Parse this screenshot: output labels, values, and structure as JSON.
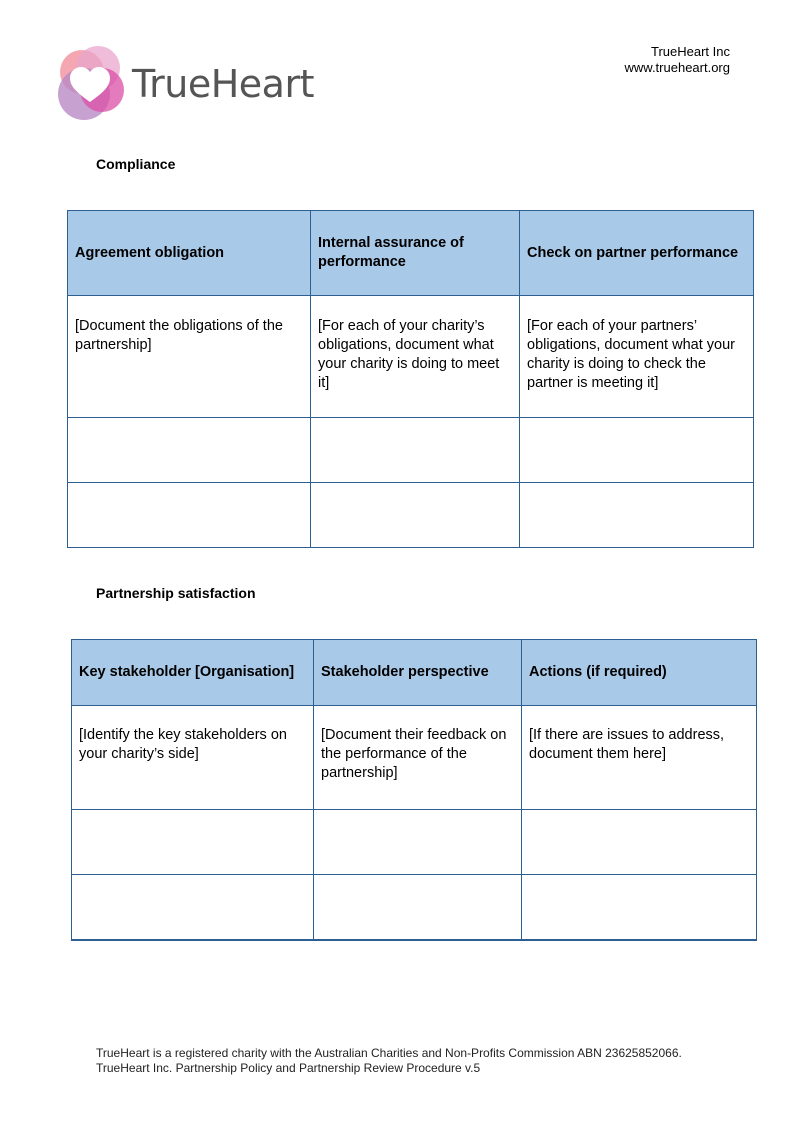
{
  "header": {
    "logo_text": "TrueHeart",
    "org_name": "TrueHeart Inc",
    "website": "www.trueheart.org"
  },
  "compliance": {
    "heading": "Compliance",
    "columns": [
      "Agreement obligation",
      "Internal assurance of performance",
      "Check on partner performance"
    ],
    "rows": [
      [
        "[Document the obligations of the partnership]",
        "[For each of your charity’s obligations, document what your charity is doing to meet it]",
        "[For each of your partners’ obligations, document what your charity is doing to check the partner is meeting it]"
      ],
      [
        "",
        "",
        ""
      ],
      [
        "",
        "",
        ""
      ]
    ]
  },
  "satisfaction": {
    "heading": "Partnership satisfaction",
    "columns": [
      "Key stakeholder [Organisation]",
      "Stakeholder perspective",
      "Actions (if required)"
    ],
    "rows": [
      [
        "[Identify the key stakeholders on your charity’s side]",
        "[Document their feedback on the performance of the partnership]",
        "[If there are issues to address, document them here]"
      ],
      [
        "",
        "",
        ""
      ],
      [
        "",
        "",
        ""
      ]
    ]
  },
  "footer": {
    "line1": "TrueHeart is a registered charity with the Australian Charities and Non-Profits Commission ABN 23625852066.",
    "line2": "TrueHeart Inc. Partnership Policy and Partnership Review Procedure v.5"
  },
  "colors": {
    "header_fill": "#a9c9e8",
    "border": "#2d5f93"
  }
}
